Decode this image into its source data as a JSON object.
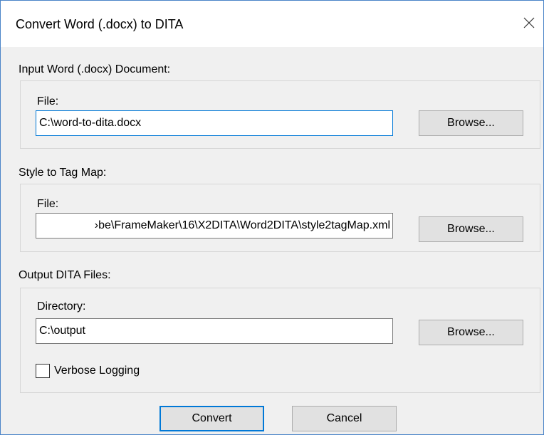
{
  "window": {
    "title": "Convert Word (.docx) to DITA",
    "close_glyph": "×"
  },
  "input_doc": {
    "section_label": "Input Word (.docx) Document:",
    "field_label": "File:",
    "value": "C:\\word-to-dita.docx",
    "browse_label": "Browse..."
  },
  "style_map": {
    "section_label": "Style to Tag Map:",
    "field_label": "File:",
    "value": "›be\\FrameMaker\\16\\X2DITA\\Word2DITA\\style2tagMap.xml",
    "browse_label": "Browse..."
  },
  "output": {
    "section_label": "Output DITA Files:",
    "field_label": "Directory:",
    "value": "C:\\output",
    "browse_label": "Browse...",
    "verbose_label": "Verbose Logging",
    "verbose_checked": false
  },
  "actions": {
    "convert_label": "Convert",
    "cancel_label": "Cancel"
  },
  "colors": {
    "accent": "#0078d7",
    "window_border": "#4a84c8",
    "dialog_bg": "#f0f0f0",
    "button_bg": "#e1e1e1"
  }
}
